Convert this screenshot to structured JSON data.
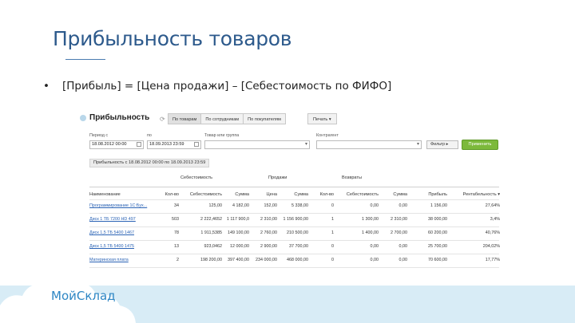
{
  "slide": {
    "title": "Прибыльность товаров",
    "bullet_symbol": "•",
    "bullet_text": "[Прибыль] = [Цена продажи] – [Себестоимость по ФИФО]",
    "logo_text": "МойСклад"
  },
  "app": {
    "page_title": "Прибыльность",
    "tabs": [
      "По товарам",
      "По сотрудникам",
      "По покупателям"
    ],
    "print_label": "Печать ▾",
    "filters": {
      "period_from_label": "Период с",
      "period_to_label": "по",
      "product_label": "Товар или группа",
      "counterparty_label": "Контрагент",
      "period_from_value": "18.08.2012 00:00",
      "period_to_value": "18.09.2013 23:59",
      "product_value": "",
      "counterparty_value": "",
      "filter_button": "Фильтр ▸",
      "apply_button": "Применить"
    },
    "period_tag": "Прибыльность с 18.08.2012 00:00 по 18.09.2013 23:59",
    "groups": [
      "Себестоимость",
      "Продажи",
      "Возвраты"
    ],
    "columns": [
      "Наименование",
      "Кол-во",
      "Себестоимость",
      "Сумма",
      "Цена",
      "Сумма",
      "Кол-во",
      "Себестоимость",
      "Сумма",
      "Прибыль",
      "Рентабельность ▾"
    ],
    "rows": [
      [
        "Программирование 1С:Бух...",
        "34",
        "125,00",
        "4 182,00",
        "152,00",
        "5 338,00",
        "0",
        "0,00",
        "0,00",
        "1 156,00",
        "27,64%"
      ],
      [
        "Диск 1 ТБ 7200 HD 497",
        "503",
        "2 222,4652",
        "1 117 900,0",
        "2 310,00",
        "1 156 900,00",
        "1",
        "1 300,00",
        "2 310,00",
        "38 000,00",
        "3,4%"
      ],
      [
        "Диск 1,5 ТБ 5400 1467",
        "78",
        "1 911,5385",
        "149 100,00",
        "2 760,00",
        "210 500,00",
        "1",
        "1 400,00",
        "2 700,00",
        "60 200,00",
        "40,76%"
      ],
      [
        "Диск 1,5 ТБ 5400 1475",
        "13",
        "923,0462",
        "12 000,00",
        "2 900,00",
        "37 700,00",
        "0",
        "0,00",
        "0,00",
        "25 700,00",
        "204,02%"
      ],
      [
        "Материнская плата",
        "2",
        "198 200,00",
        "397 400,00",
        "234 000,00",
        "468 000,00",
        "0",
        "0,00",
        "0,00",
        "70 600,00",
        "17,77%"
      ]
    ]
  },
  "colors": {
    "title": "#2d5a8c",
    "link": "#2b63b5",
    "apply": "#7cb93b",
    "footer": "#d8ecf6",
    "logo": "#2d86c4"
  }
}
